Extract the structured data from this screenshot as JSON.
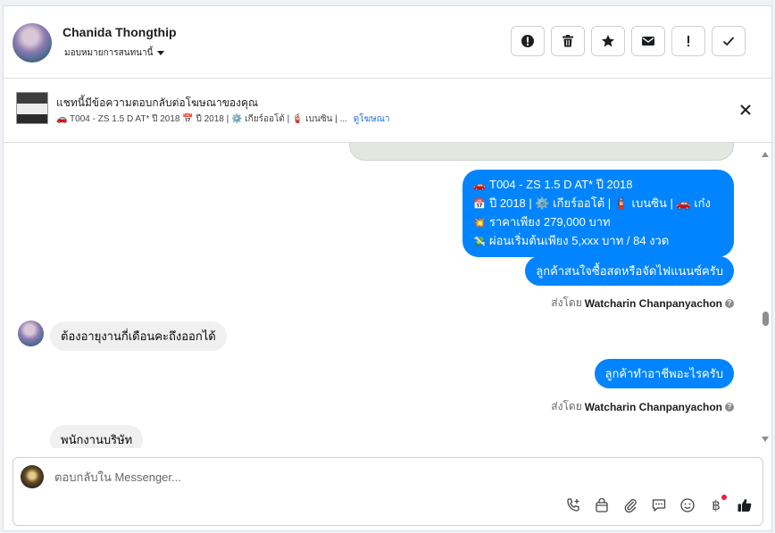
{
  "header": {
    "name": "Chanida Thongthip",
    "assign_label": "มอบหมายการสนทนานี้",
    "actions": [
      "spam-icon",
      "trash-icon",
      "star-icon",
      "mail-icon",
      "exclamation-icon",
      "check-icon"
    ]
  },
  "ad_banner": {
    "title": "แชทนี้มีข้อความตอบกลับต่อโฆษณาของคุณ",
    "subtitle": "🚗 T004 - ZS 1.5 D AT* ปี 2018 📅 ปี 2018 | ⚙️ เกียร์ออโต้ | 🧯 เบนซิน | ...",
    "link": "ดูโฆษณา"
  },
  "messages": {
    "ad_message": {
      "lines": [
        {
          "icon": "🚗",
          "text": "T004 - ZS 1.5 D AT* ปี 2018"
        },
        {
          "icon": "📅",
          "text": "ปี 2018 | ⚙️ เกียร์ออโต้ | 🧯 เบนซิน | 🚗 เก๋ง"
        },
        {
          "icon": "💥",
          "text": "ราคาเพียง 279,000 บาท"
        },
        {
          "icon": "💸",
          "text": "ผ่อนเริ่มต้นเพียง 5,xxx บาท / 84 งวด"
        }
      ]
    },
    "out_1": "ลูกค้าสนใจซื้อสดหรือจัดไฟแนนซ์ครับ",
    "sent_by_label": "ส่งโดย",
    "sent_by_name": "Watcharin Chanpanyachon",
    "in_1": "ต้องอายุงานกี่เดือนคะถึงออกได้",
    "out_2": "ลูกค้าทำอาชีพอะไรครับ",
    "in_2": "พนักงานบริษัท"
  },
  "composer": {
    "placeholder": "ตอบกลับใน Messenger...",
    "tools": [
      "call-add-icon",
      "shopping-bag-icon",
      "attachment-icon",
      "saved-reply-icon",
      "emoji-icon",
      "baht-icon",
      "thumbs-up-icon"
    ],
    "baht_symbol": "฿"
  },
  "colors": {
    "outgoing_bubble": "#0084ff",
    "incoming_bubble": "#f0f0f0",
    "link": "#216fdb"
  }
}
